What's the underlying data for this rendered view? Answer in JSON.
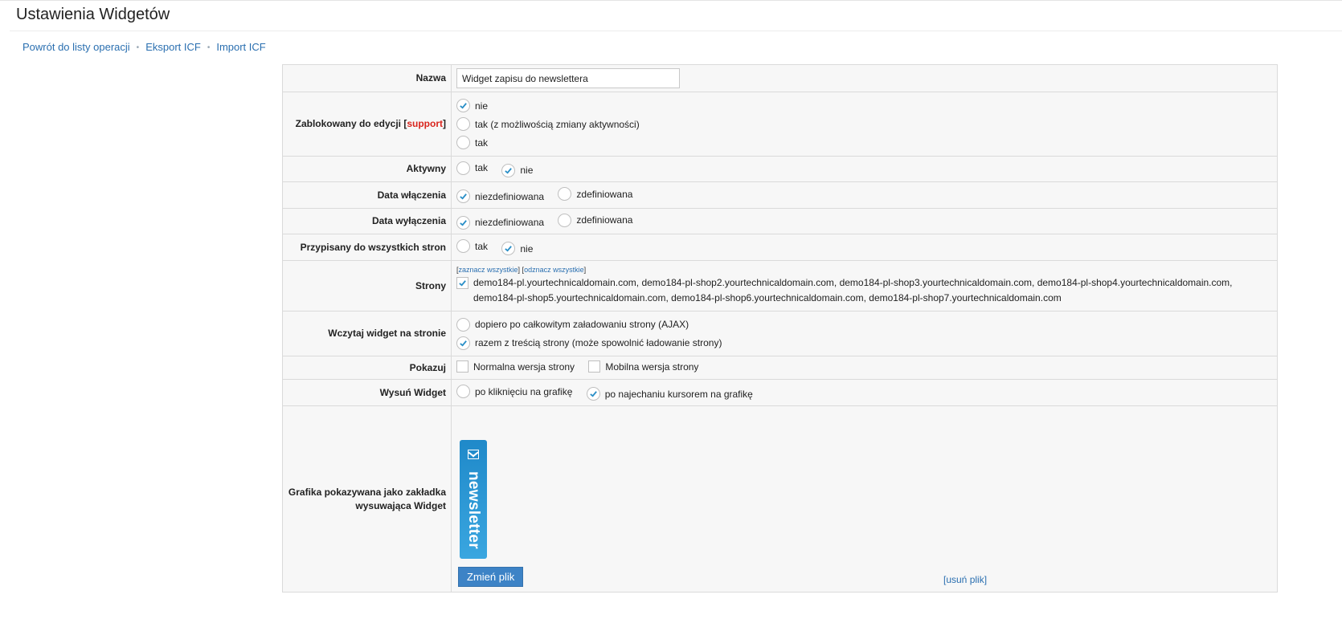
{
  "page": {
    "title": "Ustawienia Widgetów"
  },
  "nav": {
    "back": "Powrót do listy operacji",
    "export": "Eksport ICF",
    "import": "Import ICF",
    "separator": "•"
  },
  "form": {
    "name": {
      "label": "Nazwa",
      "value": "Widget zapisu do newslettera"
    },
    "locked": {
      "label": "Zablokowany do edycji [",
      "label_link": "support",
      "label_end": "]",
      "options": [
        "nie",
        "tak (z możliwością zmiany aktywności)",
        "tak"
      ],
      "selected": "nie"
    },
    "active": {
      "label": "Aktywny",
      "options": [
        "tak",
        "nie"
      ],
      "selected": "nie"
    },
    "start_date": {
      "label": "Data włączenia",
      "options": [
        "niezdefiniowana",
        "zdefiniowana"
      ],
      "selected": "niezdefiniowana"
    },
    "end_date": {
      "label": "Data wyłączenia",
      "options": [
        "niezdefiniowana",
        "zdefiniowana"
      ],
      "selected": "niezdefiniowana"
    },
    "all_pages": {
      "label": "Przypisany do wszystkich stron",
      "options": [
        "tak",
        "nie"
      ],
      "selected": "nie"
    },
    "sites": {
      "label": "Strony",
      "select_all": "zaznacz wszystkie",
      "deselect_all": "odznacz wszystkie",
      "list": "demo184-pl.yourtechnicaldomain.com, demo184-pl-shop2.yourtechnicaldomain.com, demo184-pl-shop3.yourtechnicaldomain.com, demo184-pl-shop4.yourtechnicaldomain.com, demo184-pl-shop5.yourtechnicaldomain.com, demo184-pl-shop6.yourtechnicaldomain.com, demo184-pl-shop7.yourtechnicaldomain.com",
      "checked": true
    },
    "load_mode": {
      "label": "Wczytaj widget na stronie",
      "options": [
        "dopiero po całkowitym załadowaniu strony (AJAX)",
        "razem z treścią strony (może spowolnić ładowanie strony)"
      ],
      "selected": "razem z treścią strony (może spowolnić ładowanie strony)"
    },
    "show": {
      "label": "Pokazuj",
      "options": [
        "Normalna wersja strony",
        "Mobilna wersja strony"
      ]
    },
    "slide": {
      "label": "Wysuń Widget",
      "options": [
        "po kliknięciu na grafikę",
        "po najechaniu kursorem na grafikę"
      ],
      "selected": "po najechaniu kursorem na grafikę"
    },
    "tab_image": {
      "label": "Grafika pokazywana jako zakładka wysuwająca Widget",
      "image_text": "newsletter",
      "change_button": "Zmień plik",
      "remove_link": "[usuń plik]",
      "image_color": "#2a96d6"
    }
  }
}
